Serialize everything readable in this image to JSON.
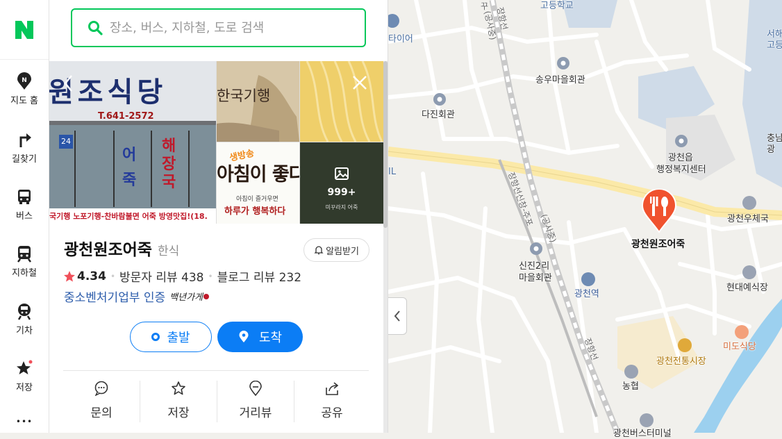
{
  "app": {
    "logo_letter": "N"
  },
  "rail": {
    "items": [
      {
        "label": "지도 홈"
      },
      {
        "label": "길찾기"
      },
      {
        "label": "버스"
      },
      {
        "label": "지하철"
      },
      {
        "label": "기차"
      },
      {
        "label": "저장"
      }
    ],
    "more_glyph": "•••"
  },
  "search": {
    "placeholder": "장소, 버스, 지하철, 도로 검색"
  },
  "photos": {
    "sign_main": "원조식당",
    "sign_phone": "T.641-2572",
    "sign_door_left": "어죽",
    "sign_door_right": "해장국",
    "sign_number": "24",
    "banner": "국기행 노포기행-찬바람불면 어죽 방영맛집!(18.",
    "thumb1_text": "한국기행",
    "thumb3_text": "아침이 좋다",
    "thumb3_badge": "생방송",
    "thumb3_line1": "아침이 즐거우면",
    "thumb3_line2": "하루가 행복하다",
    "thumb4_caption": "미꾸라지 어죽",
    "more_count": "999+"
  },
  "place": {
    "name": "광천원조어죽",
    "category": "한식",
    "alert_label": "알림받기",
    "rating": "4.34",
    "visitor_reviews": "방문자 리뷰 438",
    "blog_reviews": "블로그 리뷰 232",
    "cert": "중소벤처기업부 인증",
    "cert_brand": "백년가게"
  },
  "route": {
    "start_label": "출발",
    "arrive_label": "도착"
  },
  "actions": [
    {
      "label": "문의"
    },
    {
      "label": "저장"
    },
    {
      "label": "거리뷰"
    },
    {
      "label": "공유"
    }
  ],
  "map": {
    "pin_label": "광천원조어죽",
    "labels": {
      "l1": "고등학교",
      "l2": "타이어",
      "l3": "송우마을회관",
      "l4": "다진회관",
      "l5": "광천읍",
      "l5b": "행정복지센터",
      "l6": "서해",
      "l6b": "고등",
      "l7": "충남",
      "l7b": "광",
      "l8": "광천우체국",
      "l9": "신진2리",
      "l9b": "마을회관",
      "l10": "광천역",
      "l11": "현대예식장",
      "l12": "미도식당",
      "l13": "광천전통시장",
      "l14": "농협",
      "l15": "광천버스터미널",
      "l16": "IL",
      "rail1": "장항선",
      "rail2": "(공사중)",
      "rail3": "장항선신창-주포",
      "rail4": "(공사중)",
      "rail5": "장항선",
      "rail6": "꾸"
    },
    "colors": {
      "bg": "#f1f0ec",
      "road": "#ffffff",
      "main_road": "#fbe9a8",
      "water": "#9cd0ef",
      "block": "#cfdbe8",
      "pin": "#f0522e"
    }
  },
  "colors": {
    "brand": "#03c75a",
    "link": "#2c5cab",
    "primary": "#0b7df5",
    "star": "#f0505a"
  }
}
